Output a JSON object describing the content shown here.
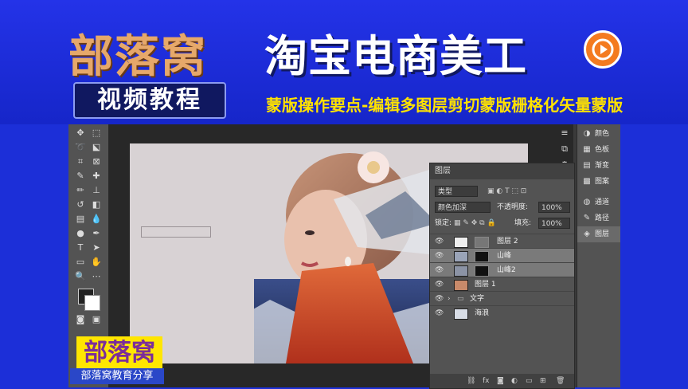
{
  "banner": {
    "brand": "部落窝",
    "brand_sub": "视频教程",
    "headline": "淘宝电商美工",
    "subtitle": "蒙版操作要点-编辑多图层剪切蒙版栅格化矢量蒙版"
  },
  "layers_panel": {
    "title": "图层",
    "filter_kind": "类型",
    "blend_mode": "颜色加深",
    "opacity_label": "不透明度:",
    "opacity_value": "100%",
    "lock_label": "锁定:",
    "fill_label": "填充:",
    "fill_value": "100%",
    "layers": [
      {
        "name": "图层 2",
        "selected": false
      },
      {
        "name": "山峰",
        "selected": true
      },
      {
        "name": "山峰2",
        "selected": true
      },
      {
        "name": "图层 1",
        "selected": false
      },
      {
        "name": "文字",
        "selected": false
      },
      {
        "name": "海浪",
        "selected": false
      }
    ],
    "footer_fx": "fx"
  },
  "right_dock": {
    "items": [
      {
        "label": "颜色",
        "icon": "color-wheel-icon"
      },
      {
        "label": "色板",
        "icon": "swatches-icon"
      },
      {
        "label": "渐变",
        "icon": "gradient-icon"
      },
      {
        "label": "图案",
        "icon": "pattern-icon"
      },
      {
        "label": "通道",
        "icon": "channels-icon"
      },
      {
        "label": "路径",
        "icon": "paths-icon"
      },
      {
        "label": "图层",
        "icon": "layers-icon"
      }
    ]
  },
  "watermark": {
    "logo": "部落窝",
    "caption": "部落窝教育分享"
  }
}
